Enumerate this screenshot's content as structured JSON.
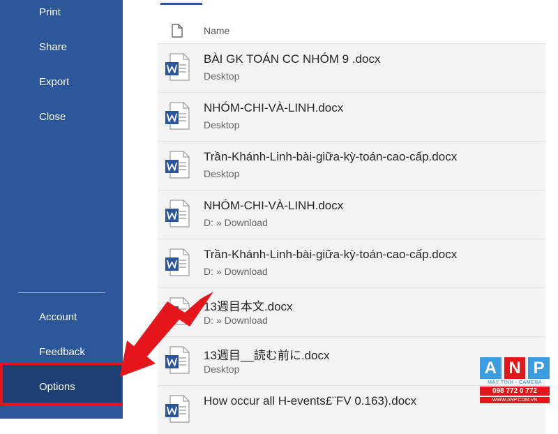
{
  "sidebar": {
    "items": [
      {
        "label": "Print"
      },
      {
        "label": "Share"
      },
      {
        "label": "Export"
      },
      {
        "label": "Close"
      }
    ],
    "bottom_items": [
      {
        "label": "Account"
      },
      {
        "label": "Feedback"
      },
      {
        "label": "Options"
      }
    ]
  },
  "file_list": {
    "header_label": "Name",
    "files": [
      {
        "name": "BÀI GK TOÁN CC NHÓM 9 .docx",
        "path": "Desktop"
      },
      {
        "name": "NHÓM-CHI-VÀ-LINH.docx",
        "path": "Desktop"
      },
      {
        "name": "Trần-Khánh-Linh-bài-giữa-kỳ-toán-cao-cấp.docx",
        "path": "Desktop"
      },
      {
        "name": "NHÓM-CHI-VÀ-LINH.docx",
        "path": "D: » Download"
      },
      {
        "name": "Trần-Khánh-Linh-bài-giữa-kỳ-toán-cao-cấp.docx",
        "path": "D: » Download"
      },
      {
        "name": "13週目本文.docx",
        "path": "D: » Download"
      },
      {
        "name": "13週目__読む前に.docx",
        "path": "Desktop"
      },
      {
        "name": "How occur all H-events£¨FV 0.163).docx",
        "path": ""
      }
    ]
  },
  "watermark": {
    "letters": [
      "A",
      "N",
      "P"
    ],
    "letter_colors": [
      "#3b9de0",
      "#e5161b",
      "#3b9de0"
    ],
    "subtitle": "MÁY TÍNH - CAMERA",
    "phone": "098 772 0 772",
    "website": "WWW.ANP.COM.VN"
  },
  "colors": {
    "sidebar": "#2b579a",
    "highlight": "#e5161b",
    "row_background": "#f3f3f3"
  }
}
